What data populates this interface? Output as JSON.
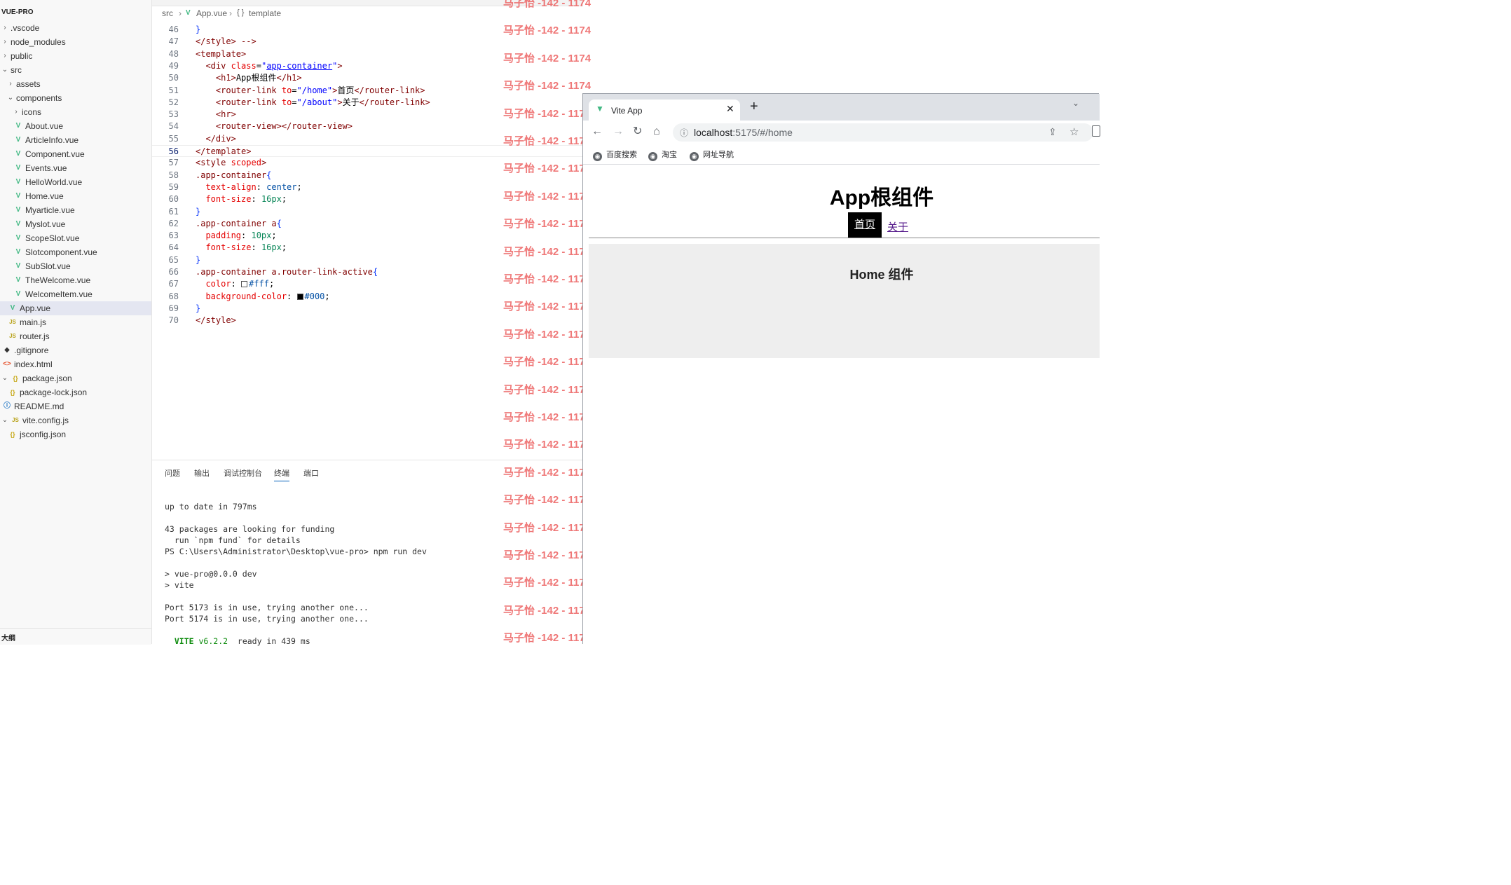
{
  "explorer": {
    "title": "VUE-PRO",
    "items": [
      {
        "label": ".vscode",
        "twisty": "›",
        "indent": 0
      },
      {
        "label": "node_modules",
        "twisty": "›",
        "indent": 0
      },
      {
        "label": "public",
        "twisty": "›",
        "indent": 0
      },
      {
        "label": "src",
        "twisty": "⌄",
        "indent": 0
      },
      {
        "label": "assets",
        "twisty": "›",
        "indent": 1
      },
      {
        "label": "components",
        "twisty": "⌄",
        "indent": 1
      },
      {
        "label": "icons",
        "twisty": "›",
        "indent": 2
      },
      {
        "label": "About.vue",
        "icon": "vue",
        "indent": 2
      },
      {
        "label": "ArticleInfo.vue",
        "icon": "vue",
        "indent": 2
      },
      {
        "label": "Component.vue",
        "icon": "vue",
        "indent": 2
      },
      {
        "label": "Events.vue",
        "icon": "vue",
        "indent": 2
      },
      {
        "label": "HelloWorld.vue",
        "icon": "vue",
        "indent": 2
      },
      {
        "label": "Home.vue",
        "icon": "vue",
        "indent": 2
      },
      {
        "label": "Myarticle.vue",
        "icon": "vue",
        "indent": 2
      },
      {
        "label": "Myslot.vue",
        "icon": "vue",
        "indent": 2
      },
      {
        "label": "ScopeSlot.vue",
        "icon": "vue",
        "indent": 2
      },
      {
        "label": "Slotcomponent.vue",
        "icon": "vue",
        "indent": 2
      },
      {
        "label": "SubSlot.vue",
        "icon": "vue",
        "indent": 2
      },
      {
        "label": "TheWelcome.vue",
        "icon": "vue",
        "indent": 2
      },
      {
        "label": "WelcomeItem.vue",
        "icon": "vue",
        "indent": 2
      },
      {
        "label": "App.vue",
        "icon": "vue",
        "indent": 1,
        "selected": true
      },
      {
        "label": "main.js",
        "icon": "js",
        "indent": 1
      },
      {
        "label": "router.js",
        "icon": "js",
        "indent": 1
      },
      {
        "label": ".gitignore",
        "icon": "git",
        "indent": 0
      },
      {
        "label": "index.html",
        "icon": "html",
        "indent": 0
      },
      {
        "label": "package.json",
        "icon": "json",
        "twisty": "⌄",
        "indent": 0
      },
      {
        "label": "package-lock.json",
        "icon": "json",
        "indent": 1
      },
      {
        "label": "README.md",
        "icon": "info",
        "indent": 0
      },
      {
        "label": "vite.config.js",
        "icon": "js",
        "twisty": "⌄",
        "indent": 0
      },
      {
        "label": "jsconfig.json",
        "icon": "json",
        "indent": 1
      }
    ],
    "outline_label": "大纲"
  },
  "breadcrumb": {
    "seg1": "src",
    "seg2": "App.vue",
    "seg3_icon": "{ }",
    "seg3": "template"
  },
  "editor": {
    "active_line": 56,
    "lines": [
      {
        "n": 46,
        "tokens": [
          [
            "brk",
            "}"
          ]
        ]
      },
      {
        "n": 47,
        "tokens": [
          [
            "tag",
            "</style>"
          ],
          [
            "txt",
            " "
          ],
          [
            "tag",
            "-->"
          ]
        ]
      },
      {
        "n": 48,
        "tokens": [
          [
            "tag",
            "<template>"
          ]
        ]
      },
      {
        "n": 49,
        "tokens": [
          [
            "txt",
            "  "
          ],
          [
            "tag",
            "<div"
          ],
          [
            "txt",
            " "
          ],
          [
            "attr",
            "class"
          ],
          [
            "txt",
            "="
          ],
          [
            "str",
            "\""
          ],
          [
            "strlink",
            "app-container"
          ],
          [
            "str",
            "\""
          ],
          [
            "tag",
            ">"
          ]
        ]
      },
      {
        "n": 50,
        "tokens": [
          [
            "txt",
            "    "
          ],
          [
            "tag",
            "<h1>"
          ],
          [
            "txt",
            "App根组件"
          ],
          [
            "tag",
            "</h1>"
          ]
        ]
      },
      {
        "n": 51,
        "tokens": [
          [
            "txt",
            "    "
          ],
          [
            "tag",
            "<router-link"
          ],
          [
            "txt",
            " "
          ],
          [
            "attr",
            "to"
          ],
          [
            "txt",
            "="
          ],
          [
            "str",
            "\"/home\""
          ],
          [
            "tag",
            ">"
          ],
          [
            "txt",
            "首页"
          ],
          [
            "tag",
            "</router-link>"
          ]
        ]
      },
      {
        "n": 52,
        "tokens": [
          [
            "txt",
            "    "
          ],
          [
            "tag",
            "<router-link"
          ],
          [
            "txt",
            " "
          ],
          [
            "attr",
            "to"
          ],
          [
            "txt",
            "="
          ],
          [
            "str",
            "\"/about\""
          ],
          [
            "tag",
            ">"
          ],
          [
            "txt",
            "关于"
          ],
          [
            "tag",
            "</router-link>"
          ]
        ]
      },
      {
        "n": 53,
        "tokens": [
          [
            "txt",
            "    "
          ],
          [
            "tag",
            "<hr>"
          ]
        ]
      },
      {
        "n": 54,
        "tokens": [
          [
            "txt",
            "    "
          ],
          [
            "tag",
            "<router-view></router-view>"
          ]
        ]
      },
      {
        "n": 55,
        "tokens": [
          [
            "txt",
            "  "
          ],
          [
            "tag",
            "</div>"
          ]
        ]
      },
      {
        "n": 56,
        "tokens": [
          [
            "tag",
            "</template>"
          ]
        ]
      },
      {
        "n": 57,
        "tokens": [
          [
            "tag",
            "<style"
          ],
          [
            "txt",
            " "
          ],
          [
            "attr",
            "scoped"
          ],
          [
            "tag",
            ">"
          ]
        ]
      },
      {
        "n": 58,
        "tokens": [
          [
            "sel",
            ".app-container"
          ],
          [
            "brk",
            "{"
          ]
        ]
      },
      {
        "n": 59,
        "tokens": [
          [
            "txt",
            "  "
          ],
          [
            "prop",
            "text-align"
          ],
          [
            "txt",
            ": "
          ],
          [
            "kw",
            "center"
          ],
          [
            "txt",
            ";"
          ]
        ]
      },
      {
        "n": 60,
        "tokens": [
          [
            "txt",
            "  "
          ],
          [
            "prop",
            "font-size"
          ],
          [
            "txt",
            ": "
          ],
          [
            "val",
            "16px"
          ],
          [
            "txt",
            ";"
          ]
        ]
      },
      {
        "n": 61,
        "tokens": [
          [
            "brk",
            "}"
          ]
        ]
      },
      {
        "n": 62,
        "tokens": [
          [
            "sel",
            ".app-container a"
          ],
          [
            "brk",
            "{"
          ]
        ]
      },
      {
        "n": 63,
        "tokens": [
          [
            "txt",
            "  "
          ],
          [
            "prop",
            "padding"
          ],
          [
            "txt",
            ": "
          ],
          [
            "val",
            "10px"
          ],
          [
            "txt",
            ";"
          ]
        ]
      },
      {
        "n": 64,
        "tokens": [
          [
            "txt",
            "  "
          ],
          [
            "prop",
            "font-size"
          ],
          [
            "txt",
            ": "
          ],
          [
            "val",
            "16px"
          ],
          [
            "txt",
            ";"
          ]
        ]
      },
      {
        "n": 65,
        "tokens": [
          [
            "brk",
            "}"
          ]
        ]
      },
      {
        "n": 66,
        "tokens": [
          [
            "sel",
            ".app-container a.router-link-active"
          ],
          [
            "brk",
            "{"
          ]
        ]
      },
      {
        "n": 67,
        "tokens": [
          [
            "txt",
            "  "
          ],
          [
            "prop",
            "color"
          ],
          [
            "txt",
            ": "
          ],
          [
            "swatch",
            "#ffffff"
          ],
          [
            "kw",
            "#fff"
          ],
          [
            "txt",
            ";"
          ]
        ]
      },
      {
        "n": 68,
        "tokens": [
          [
            "txt",
            "  "
          ],
          [
            "prop",
            "background-color"
          ],
          [
            "txt",
            ": "
          ],
          [
            "swatch",
            "#000000"
          ],
          [
            "kw",
            "#000"
          ],
          [
            "txt",
            ";"
          ]
        ]
      },
      {
        "n": 69,
        "tokens": [
          [
            "brk",
            "}"
          ]
        ]
      },
      {
        "n": 70,
        "tokens": [
          [
            "tag",
            "</style>"
          ]
        ]
      }
    ]
  },
  "panel": {
    "tabs": [
      "问题",
      "输出",
      "调试控制台",
      "终端",
      "端口"
    ],
    "active_tab": "终端",
    "terminal": [
      {
        "text": "up to date in 797ms"
      },
      {
        "text": ""
      },
      {
        "text": "43 packages are looking for funding"
      },
      {
        "text": "  run `npm fund` for details"
      },
      {
        "text": "PS C:\\Users\\Administrator\\Desktop\\vue-pro> npm run dev"
      },
      {
        "text": ""
      },
      {
        "text": "> vue-pro@0.0.0 dev"
      },
      {
        "text": "> vite"
      },
      {
        "text": ""
      },
      {
        "text": "Port 5173 is in use, trying another one..."
      },
      {
        "text": "Port 5174 is in use, trying another one..."
      },
      {
        "text": ""
      }
    ],
    "vite_line": {
      "name": "VITE",
      "version": "v6.2.2",
      "rest": "  ready in 439 ms"
    }
  },
  "watermark": {
    "text": "马子怡 -142 - 1174",
    "count": 24
  },
  "browser": {
    "tab_title": "Vite App",
    "tab_close": "✕",
    "new_tab": "+",
    "tab_search": "⌄",
    "nav": {
      "back": "←",
      "forward": "→",
      "reload": "↻",
      "home": "⌂"
    },
    "url_host": "localhost",
    "url_path": ":5175/#/home",
    "bookmarks": [
      "百度搜索",
      "淘宝",
      "网址导航"
    ],
    "page": {
      "h1": "App根组件",
      "link_home": "首页",
      "link_about": "关于",
      "home_title": "Home 组件"
    }
  }
}
